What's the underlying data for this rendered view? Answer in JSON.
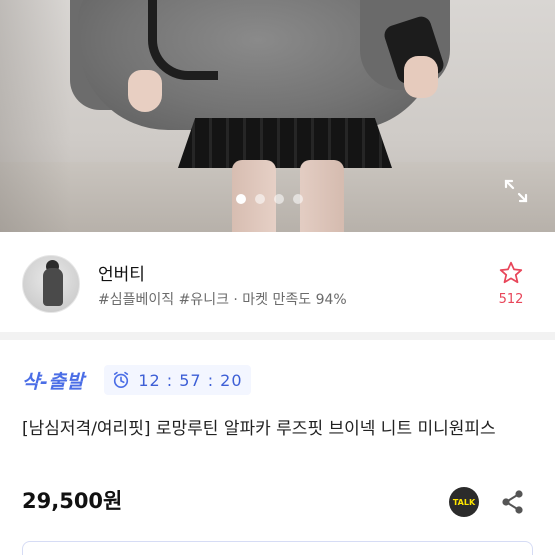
{
  "product": {
    "image_count": 4,
    "active_image": 1
  },
  "seller": {
    "name": "언버티",
    "tags": "#심플베이직 #유니크 · 마켓 만족도 94%",
    "like_count": "512"
  },
  "shipping": {
    "badge": "샥-출발",
    "timer": "12 : 57 : 20"
  },
  "item": {
    "title": "[남심저격/여리핏] 로망루틴 알파카 루즈핏 브이넥 니트 미니원피스",
    "price": "29,500원"
  },
  "actions": {
    "talk_label": "TALK"
  },
  "icons": {
    "expand": "expand-icon",
    "like": "star-icon",
    "clock": "clock-icon",
    "share": "share-icon"
  },
  "colors": {
    "accent": "#4b6ee6",
    "like": "#e8465a"
  }
}
